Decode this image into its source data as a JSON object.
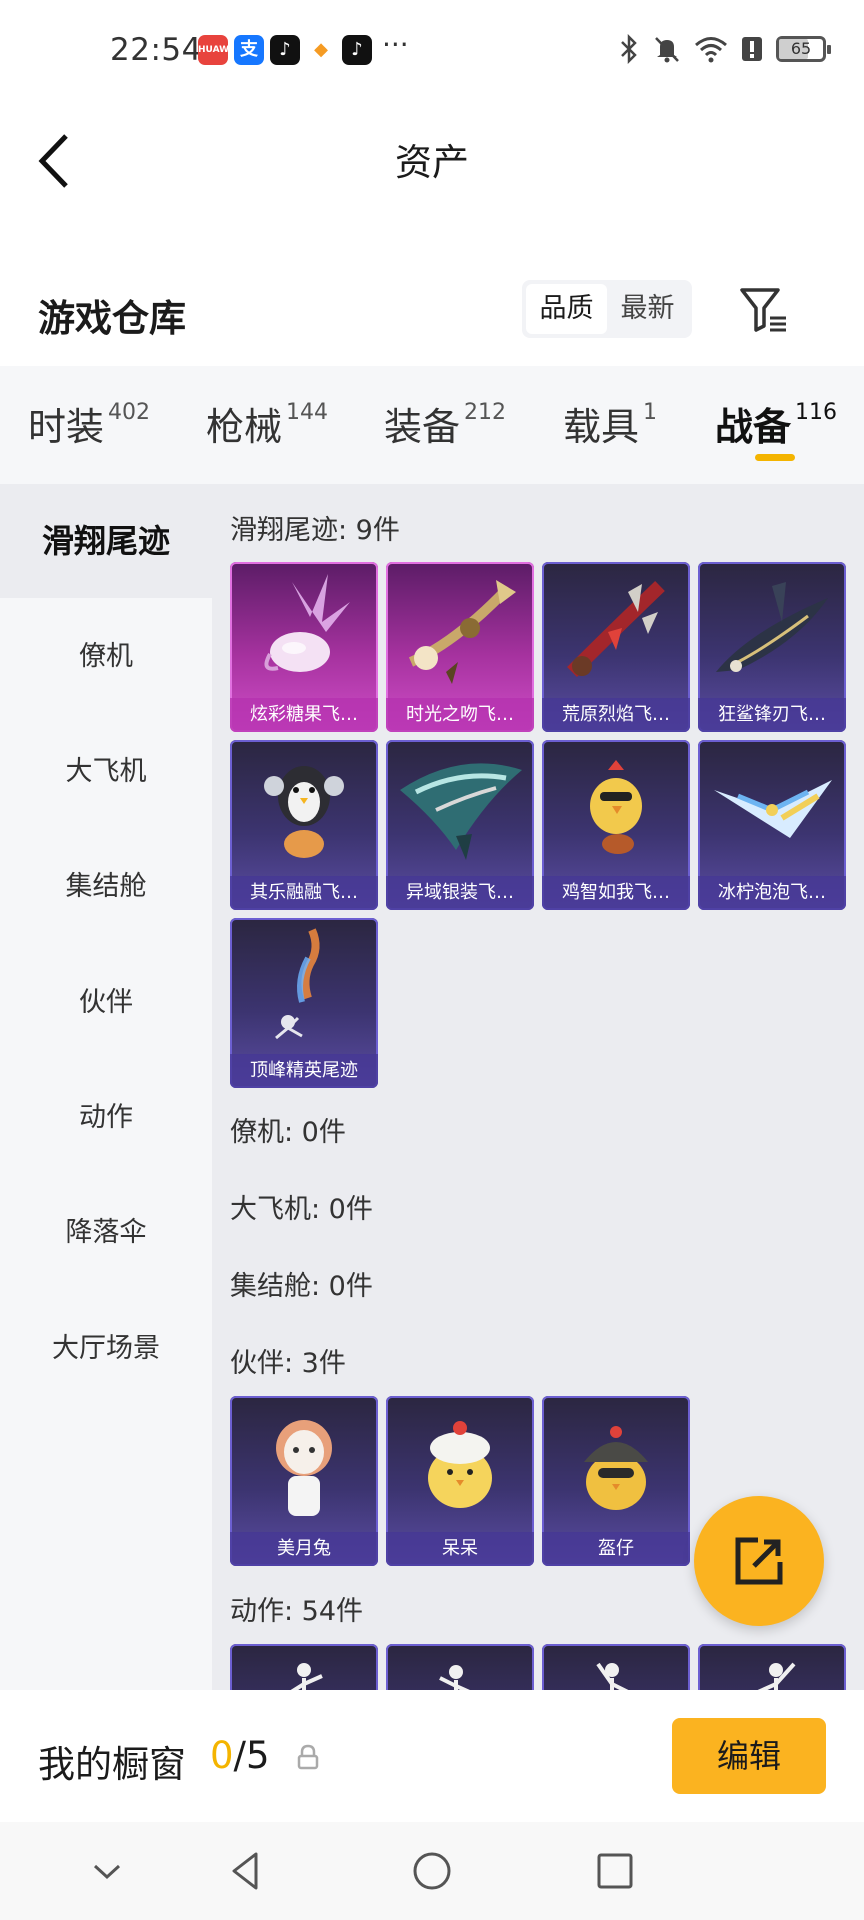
{
  "status_bar": {
    "time": "22:54",
    "more_indicator": "···",
    "battery": "65",
    "battery_level": 0.65,
    "app_icons": [
      {
        "name": "huawei-store-icon",
        "color": "#e8433d"
      },
      {
        "name": "alipay-icon",
        "color": "#1677ff",
        "glyph": "支"
      },
      {
        "name": "tiktok-icon",
        "color": "#111111",
        "glyph": "♪"
      },
      {
        "name": "game-app-icon",
        "color": "#f59b23"
      },
      {
        "name": "tiktok-icon-2",
        "color": "#111111",
        "glyph": "♪"
      }
    ]
  },
  "header": {
    "title": "资产"
  },
  "warehouse": {
    "title": "游戏仓库",
    "sort_options": [
      "品质",
      "最新"
    ],
    "active_sort": 0
  },
  "tabs": [
    {
      "label": "时装",
      "count": "402"
    },
    {
      "label": "枪械",
      "count": "144"
    },
    {
      "label": "装备",
      "count": "212"
    },
    {
      "label": "载具",
      "count": "1"
    },
    {
      "label": "战备",
      "count": "116"
    }
  ],
  "active_tab": 4,
  "sidebar": {
    "items": [
      "滑翔尾迹",
      "僚机",
      "大飞机",
      "集结舱",
      "伙伴",
      "动作",
      "降落伞",
      "大厅场景"
    ],
    "active": 0
  },
  "sections": {
    "glide_trails": {
      "title": "滑翔尾迹: 9件",
      "items": [
        "炫彩糖果飞…",
        "时光之吻飞…",
        "荒原烈焰飞…",
        "狂鲨锋刃飞…",
        "其乐融融飞…",
        "异域银装飞…",
        "鸡智如我飞…",
        "冰柠泡泡飞…",
        "顶峰精英尾迹"
      ]
    },
    "wingmen": {
      "title": "僚机: 0件"
    },
    "big_planes": {
      "title": "大飞机: 0件"
    },
    "capsules": {
      "title": "集结舱: 0件"
    },
    "partners": {
      "title": "伙伴: 3件",
      "items": [
        "美月兔",
        "呆呆",
        "盔仔"
      ]
    },
    "actions": {
      "title": "动作: 54件"
    }
  },
  "showcase": {
    "label": "我的橱窗",
    "current": "0",
    "total": "/5",
    "edit_label": "编辑"
  },
  "colors": {
    "accent": "#fbb320",
    "legendary": "#d04ec8",
    "epic": "#5b4da3"
  }
}
